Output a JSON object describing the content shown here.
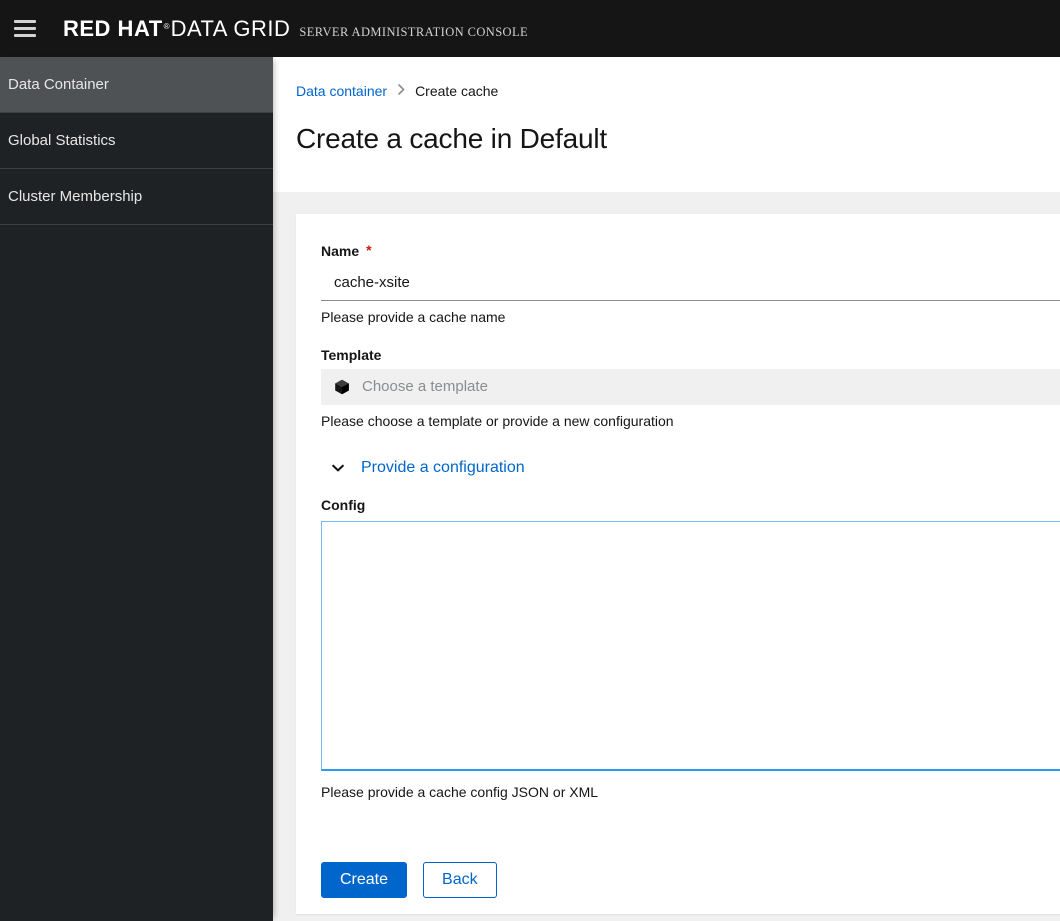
{
  "masthead": {
    "nav_toggle_label": "Global navigation",
    "brand_primary": "RED HAT",
    "brand_registered": "®",
    "brand_secondary": "DATA GRID",
    "brand_subtitle": "SERVER ADMINISTRATION CONSOLE",
    "background": "#151515"
  },
  "sidebar": {
    "items": [
      {
        "label": "Data Container",
        "active": true
      },
      {
        "label": "Global Statistics",
        "active": false
      },
      {
        "label": "Cluster Membership",
        "active": false
      }
    ],
    "background": "#1f2225",
    "active_background": "#4f5255"
  },
  "breadcrumb": {
    "link_label": "Data container",
    "separator": "›",
    "current_label": "Create cache",
    "link_color": "#0066cc"
  },
  "page": {
    "title": "Create a cache in Default"
  },
  "form": {
    "name": {
      "label": "Name",
      "required_marker": "*",
      "value": "cache-xsite",
      "placeholder": "",
      "helper": "Please provide a cache name"
    },
    "template": {
      "label": "Template",
      "icon": "cube-icon",
      "placeholder": "Choose a template",
      "value": "",
      "helper": "Please choose a template or provide a new configuration"
    },
    "expandable": {
      "label": "Provide a configuration",
      "icon": "chevron-down-icon",
      "expanded": true
    },
    "config": {
      "label": "Config",
      "value": "",
      "placeholder": "",
      "helper": "Please provide a cache config JSON or XML"
    }
  },
  "actions": {
    "create_label": "Create",
    "back_label": "Back",
    "primary_color": "#0066cc"
  }
}
